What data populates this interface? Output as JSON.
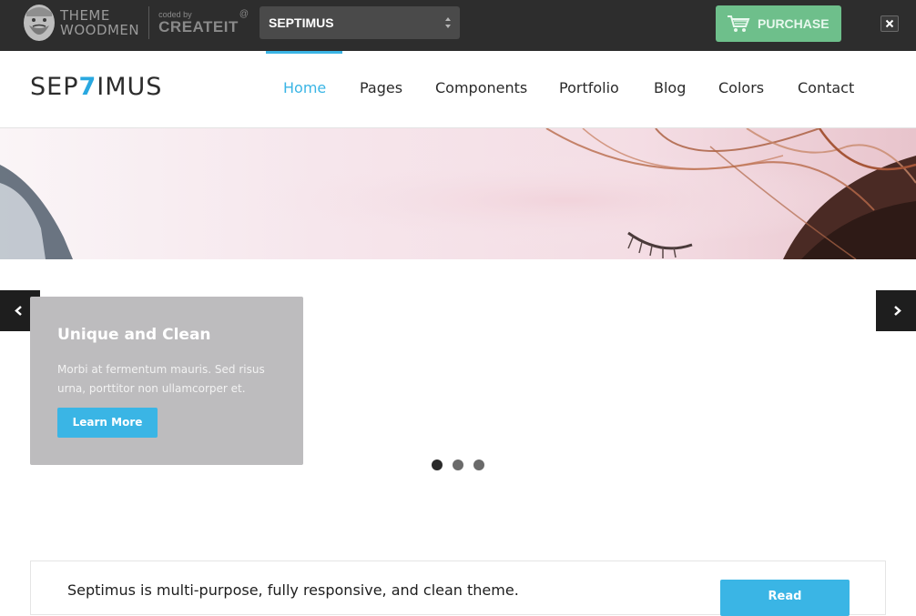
{
  "topbar": {
    "brand_line1": "THEME",
    "brand_line2": "WOODMEN",
    "coded_by": "coded by",
    "createit": "CREATEIT",
    "at_symbol": "@",
    "theme_select": {
      "value": "SEPTIMUS"
    },
    "purchase_label": "PURCHASE",
    "close_icon": "close-icon"
  },
  "header": {
    "logo": {
      "pre": "SEP",
      "digit": "7",
      "post": "IMUS"
    },
    "nav": [
      "Home",
      "Pages",
      "Components",
      "Portfolio",
      "Blog",
      "Colors",
      "Contact"
    ],
    "active_nav": "Home"
  },
  "slider": {
    "caption_title": "Unique and Clean",
    "caption_text": "Morbi at fermentum mauris. Sed risus urna, porttitor non ullamcorper et.",
    "button_label": "Learn More",
    "slide_count": 3,
    "active_slide": 1,
    "prev_icon": "chevron-left-icon",
    "next_icon": "chevron-right-icon"
  },
  "promo": {
    "text": "Septimus is multi-purpose, fully responsive, and clean theme.",
    "button_label": "Read"
  },
  "colors": {
    "accent": "#3ab5e5",
    "topbar_bg": "#2d2d2d",
    "purchase_bg": "#6ebf8b",
    "caption_bg": "#bdbcbe"
  }
}
